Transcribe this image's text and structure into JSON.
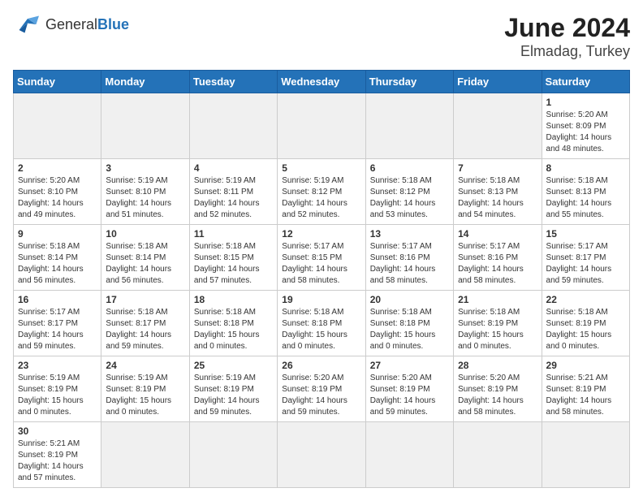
{
  "header": {
    "logo_general": "General",
    "logo_blue": "Blue",
    "title": "June 2024",
    "subtitle": "Elmadag, Turkey"
  },
  "days_of_week": [
    "Sunday",
    "Monday",
    "Tuesday",
    "Wednesday",
    "Thursday",
    "Friday",
    "Saturday"
  ],
  "weeks": [
    [
      {
        "day": null,
        "info": null
      },
      {
        "day": null,
        "info": null
      },
      {
        "day": null,
        "info": null
      },
      {
        "day": null,
        "info": null
      },
      {
        "day": null,
        "info": null
      },
      {
        "day": null,
        "info": null
      },
      {
        "day": "1",
        "info": "Sunrise: 5:20 AM\nSunset: 8:09 PM\nDaylight: 14 hours\nand 48 minutes."
      }
    ],
    [
      {
        "day": "2",
        "info": "Sunrise: 5:20 AM\nSunset: 8:10 PM\nDaylight: 14 hours\nand 49 minutes."
      },
      {
        "day": "3",
        "info": "Sunrise: 5:19 AM\nSunset: 8:10 PM\nDaylight: 14 hours\nand 51 minutes."
      },
      {
        "day": "4",
        "info": "Sunrise: 5:19 AM\nSunset: 8:11 PM\nDaylight: 14 hours\nand 52 minutes."
      },
      {
        "day": "5",
        "info": "Sunrise: 5:19 AM\nSunset: 8:12 PM\nDaylight: 14 hours\nand 52 minutes."
      },
      {
        "day": "6",
        "info": "Sunrise: 5:18 AM\nSunset: 8:12 PM\nDaylight: 14 hours\nand 53 minutes."
      },
      {
        "day": "7",
        "info": "Sunrise: 5:18 AM\nSunset: 8:13 PM\nDaylight: 14 hours\nand 54 minutes."
      },
      {
        "day": "8",
        "info": "Sunrise: 5:18 AM\nSunset: 8:13 PM\nDaylight: 14 hours\nand 55 minutes."
      }
    ],
    [
      {
        "day": "9",
        "info": "Sunrise: 5:18 AM\nSunset: 8:14 PM\nDaylight: 14 hours\nand 56 minutes."
      },
      {
        "day": "10",
        "info": "Sunrise: 5:18 AM\nSunset: 8:14 PM\nDaylight: 14 hours\nand 56 minutes."
      },
      {
        "day": "11",
        "info": "Sunrise: 5:18 AM\nSunset: 8:15 PM\nDaylight: 14 hours\nand 57 minutes."
      },
      {
        "day": "12",
        "info": "Sunrise: 5:17 AM\nSunset: 8:15 PM\nDaylight: 14 hours\nand 58 minutes."
      },
      {
        "day": "13",
        "info": "Sunrise: 5:17 AM\nSunset: 8:16 PM\nDaylight: 14 hours\nand 58 minutes."
      },
      {
        "day": "14",
        "info": "Sunrise: 5:17 AM\nSunset: 8:16 PM\nDaylight: 14 hours\nand 58 minutes."
      },
      {
        "day": "15",
        "info": "Sunrise: 5:17 AM\nSunset: 8:17 PM\nDaylight: 14 hours\nand 59 minutes."
      }
    ],
    [
      {
        "day": "16",
        "info": "Sunrise: 5:17 AM\nSunset: 8:17 PM\nDaylight: 14 hours\nand 59 minutes."
      },
      {
        "day": "17",
        "info": "Sunrise: 5:18 AM\nSunset: 8:17 PM\nDaylight: 14 hours\nand 59 minutes."
      },
      {
        "day": "18",
        "info": "Sunrise: 5:18 AM\nSunset: 8:18 PM\nDaylight: 15 hours\nand 0 minutes."
      },
      {
        "day": "19",
        "info": "Sunrise: 5:18 AM\nSunset: 8:18 PM\nDaylight: 15 hours\nand 0 minutes."
      },
      {
        "day": "20",
        "info": "Sunrise: 5:18 AM\nSunset: 8:18 PM\nDaylight: 15 hours\nand 0 minutes."
      },
      {
        "day": "21",
        "info": "Sunrise: 5:18 AM\nSunset: 8:19 PM\nDaylight: 15 hours\nand 0 minutes."
      },
      {
        "day": "22",
        "info": "Sunrise: 5:18 AM\nSunset: 8:19 PM\nDaylight: 15 hours\nand 0 minutes."
      }
    ],
    [
      {
        "day": "23",
        "info": "Sunrise: 5:19 AM\nSunset: 8:19 PM\nDaylight: 15 hours\nand 0 minutes."
      },
      {
        "day": "24",
        "info": "Sunrise: 5:19 AM\nSunset: 8:19 PM\nDaylight: 15 hours\nand 0 minutes."
      },
      {
        "day": "25",
        "info": "Sunrise: 5:19 AM\nSunset: 8:19 PM\nDaylight: 14 hours\nand 59 minutes."
      },
      {
        "day": "26",
        "info": "Sunrise: 5:20 AM\nSunset: 8:19 PM\nDaylight: 14 hours\nand 59 minutes."
      },
      {
        "day": "27",
        "info": "Sunrise: 5:20 AM\nSunset: 8:19 PM\nDaylight: 14 hours\nand 59 minutes."
      },
      {
        "day": "28",
        "info": "Sunrise: 5:20 AM\nSunset: 8:19 PM\nDaylight: 14 hours\nand 58 minutes."
      },
      {
        "day": "29",
        "info": "Sunrise: 5:21 AM\nSunset: 8:19 PM\nDaylight: 14 hours\nand 58 minutes."
      }
    ],
    [
      {
        "day": "30",
        "info": "Sunrise: 5:21 AM\nSunset: 8:19 PM\nDaylight: 14 hours\nand 57 minutes."
      },
      {
        "day": null,
        "info": null
      },
      {
        "day": null,
        "info": null
      },
      {
        "day": null,
        "info": null
      },
      {
        "day": null,
        "info": null
      },
      {
        "day": null,
        "info": null
      },
      {
        "day": null,
        "info": null
      }
    ]
  ]
}
